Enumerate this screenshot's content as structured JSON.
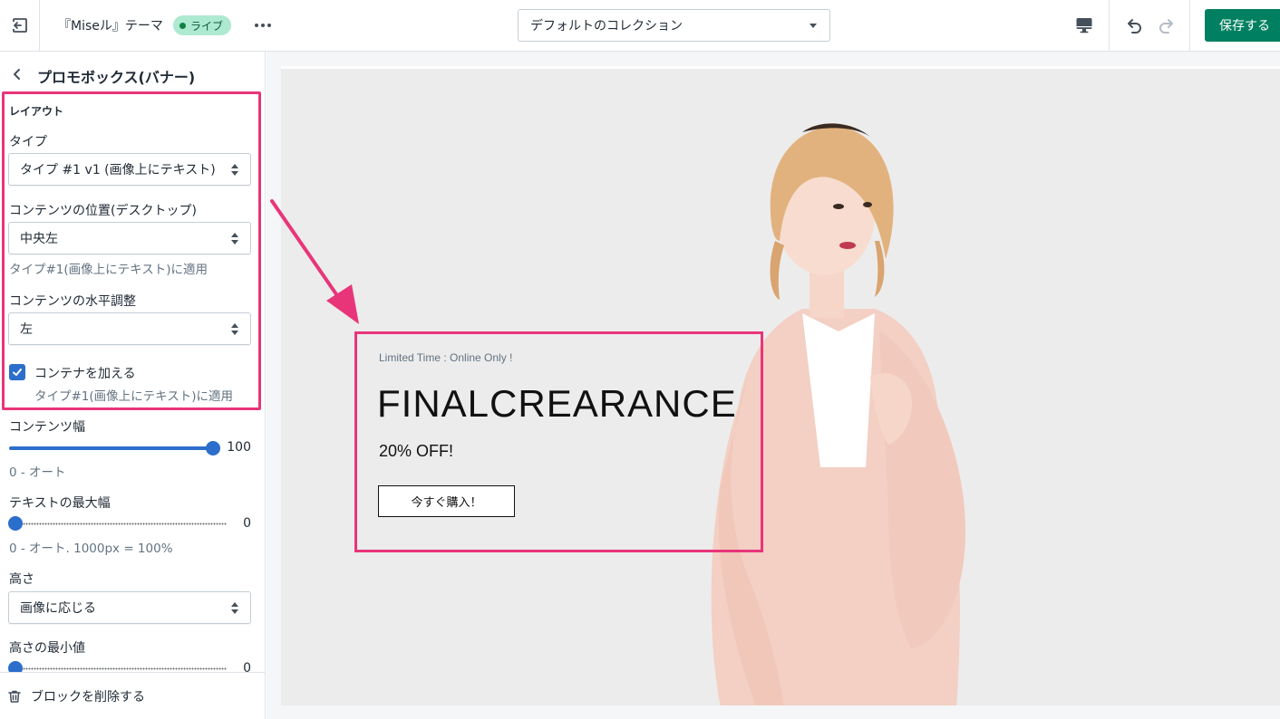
{
  "topbar": {
    "theme_name": "『Miseル』テーマ",
    "live_badge": "ライブ",
    "collection_select": "デフォルトのコレクション",
    "save_label": "保存する"
  },
  "sidebar": {
    "title": "プロモボックス(バナー)",
    "section_heading": "レイアウト",
    "type_label": "タイプ",
    "type_value": "タイプ #1 v1 (画像上にテキスト)",
    "position_label": "コンテンツの位置(デスクトップ)",
    "position_value": "中央左",
    "position_help": "タイプ#1(画像上にテキスト)に適用",
    "halign_label": "コンテンツの水平調整",
    "halign_value": "左",
    "container_label": "コンテナを加える",
    "container_checked": true,
    "container_help": "タイプ#1(画像上にテキスト)に適用",
    "content_width_label": "コンテンツ幅",
    "content_width_value": "100",
    "content_width_help": "0 - オート",
    "max_width_label": "テキストの最大幅",
    "max_width_value": "0",
    "max_width_help": "0 - オート. 1000px = 100%",
    "height_label": "高さ",
    "height_value": "画像に応じる",
    "min_height_label": "高さの最小値",
    "min_height_value": "0",
    "delete_label": "ブロックを削除する"
  },
  "preview": {
    "kicker": "Limited Time : Online Only !",
    "heading": "FINALCREARANCE",
    "subheading": "20% OFF!",
    "button_label": "今すぐ購入！"
  },
  "colors": {
    "accent": "#008060",
    "highlight": "#e8357a",
    "live_badge_bg": "#aee9d1",
    "slider": "#2c6ecb"
  },
  "icons": [
    "exit-icon",
    "more-icon",
    "chevron-down-icon",
    "desktop-icon",
    "undo-icon",
    "redo-icon",
    "back-icon",
    "checkmark-icon",
    "trash-icon",
    "annotation-arrow"
  ]
}
